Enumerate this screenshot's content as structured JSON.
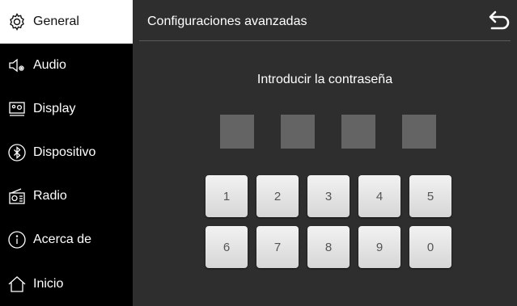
{
  "sidebar": {
    "items": [
      {
        "label": "General",
        "icon": "gear-icon",
        "active": true
      },
      {
        "label": "Audio",
        "icon": "speaker-settings-icon"
      },
      {
        "label": "Display",
        "icon": "display-icon"
      },
      {
        "label": "Dispositivo",
        "icon": "bluetooth-icon"
      },
      {
        "label": "Radio",
        "icon": "radio-icon"
      },
      {
        "label": "Acerca de",
        "icon": "info-icon"
      },
      {
        "label": "Inicio",
        "icon": "home-icon"
      }
    ]
  },
  "header": {
    "title": "Configuraciones avanzadas",
    "back_icon": "back-arrow-icon"
  },
  "main": {
    "prompt": "Introducir la contraseña",
    "pin_length": 4,
    "keypad": [
      "1",
      "2",
      "3",
      "4",
      "5",
      "6",
      "7",
      "8",
      "9",
      "0"
    ]
  },
  "colors": {
    "sidebar_bg": "#000000",
    "main_bg": "#2e2e2e",
    "active_item_bg": "#ffffff",
    "pin_box": "#646464",
    "key_bg": "#e6e6e6"
  }
}
